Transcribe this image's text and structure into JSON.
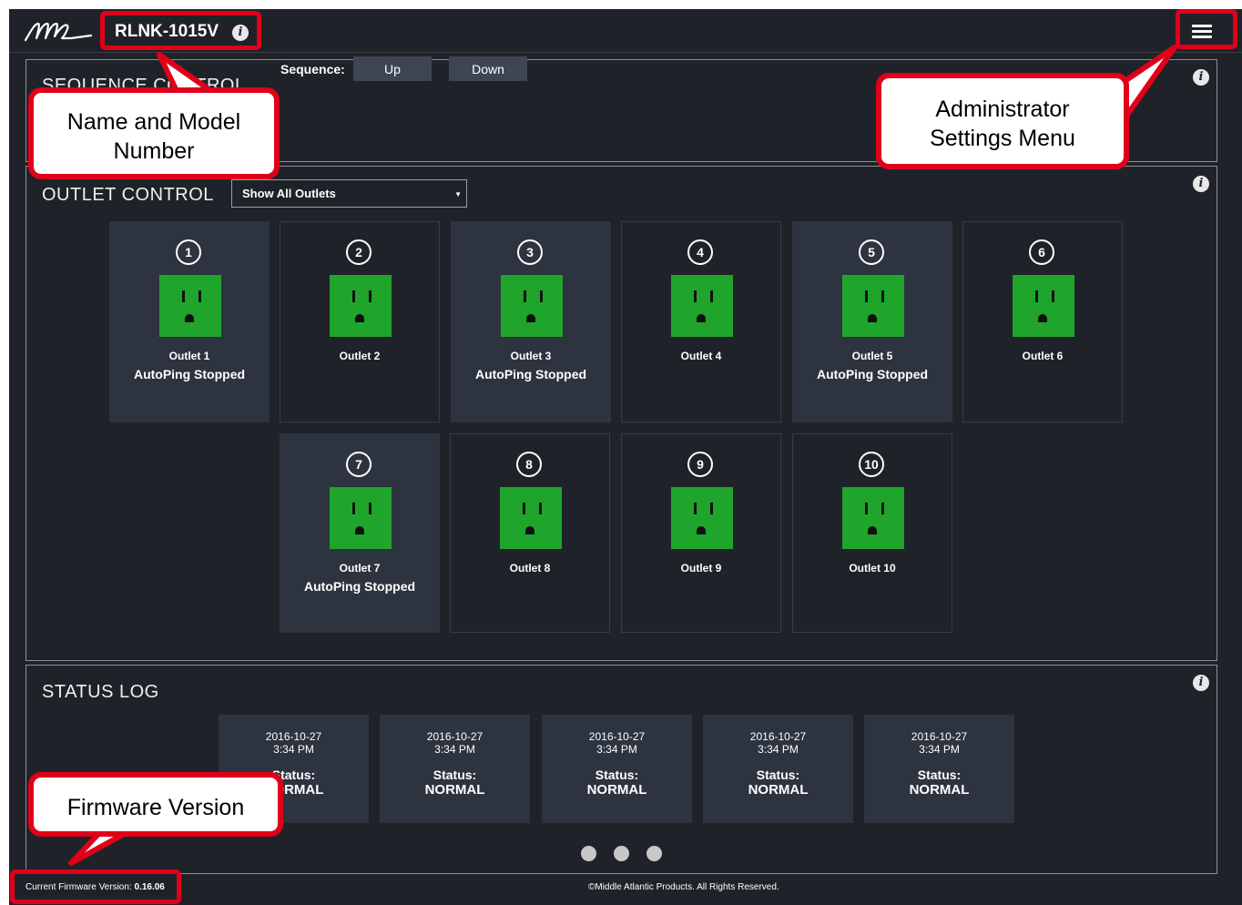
{
  "header": {
    "device_name": "RLNK-1015V",
    "info_icon": "info-icon",
    "menu_icon": "hamburger-menu-icon"
  },
  "sequence_control": {
    "title": "SEQUENCE CONTROL",
    "label": "Sequence:",
    "up_label": "Up",
    "down_label": "Down"
  },
  "outlet_control": {
    "title": "OUTLET CONTROL",
    "filter_selected": "Show All Outlets",
    "socket_color": "#1fa52b",
    "outlets": [
      {
        "number": "1",
        "name": "Outlet 1",
        "status": "AutoPing Stopped",
        "active": true
      },
      {
        "number": "2",
        "name": "Outlet 2",
        "status": "",
        "active": false
      },
      {
        "number": "3",
        "name": "Outlet 3",
        "status": "AutoPing Stopped",
        "active": true
      },
      {
        "number": "4",
        "name": "Outlet 4",
        "status": "",
        "active": false
      },
      {
        "number": "5",
        "name": "Outlet 5",
        "status": "AutoPing Stopped",
        "active": true
      },
      {
        "number": "6",
        "name": "Outlet 6",
        "status": "",
        "active": false
      },
      {
        "number": "7",
        "name": "Outlet 7",
        "status": "AutoPing Stopped",
        "active": true
      },
      {
        "number": "8",
        "name": "Outlet 8",
        "status": "",
        "active": false
      },
      {
        "number": "9",
        "name": "Outlet 9",
        "status": "",
        "active": false
      },
      {
        "number": "10",
        "name": "Outlet 10",
        "status": "",
        "active": false
      }
    ]
  },
  "status_log": {
    "title": "STATUS LOG",
    "entries": [
      {
        "date": "2016-10-27",
        "time": "3:34 PM",
        "status_label": "Status:",
        "status": "NORMAL"
      },
      {
        "date": "2016-10-27",
        "time": "3:34 PM",
        "status_label": "Status:",
        "status": "NORMAL"
      },
      {
        "date": "2016-10-27",
        "time": "3:34 PM",
        "status_label": "Status:",
        "status": "NORMAL"
      },
      {
        "date": "2016-10-27",
        "time": "3:34 PM",
        "status_label": "Status:",
        "status": "NORMAL"
      },
      {
        "date": "2016-10-27",
        "time": "3:34 PM",
        "status_label": "Status:",
        "status": "NORMAL"
      }
    ],
    "pages": 3
  },
  "footer": {
    "firmware_label": "Current Firmware Version:",
    "firmware_version": "0.16.06",
    "copyright": "©Middle Atlantic Products. All Rights Reserved."
  },
  "annotations": {
    "name_model": "Name and Model Number",
    "admin_menu": "Administrator Settings Menu",
    "firmware": "Firmware Version",
    "highlight_color": "#e0001a"
  }
}
